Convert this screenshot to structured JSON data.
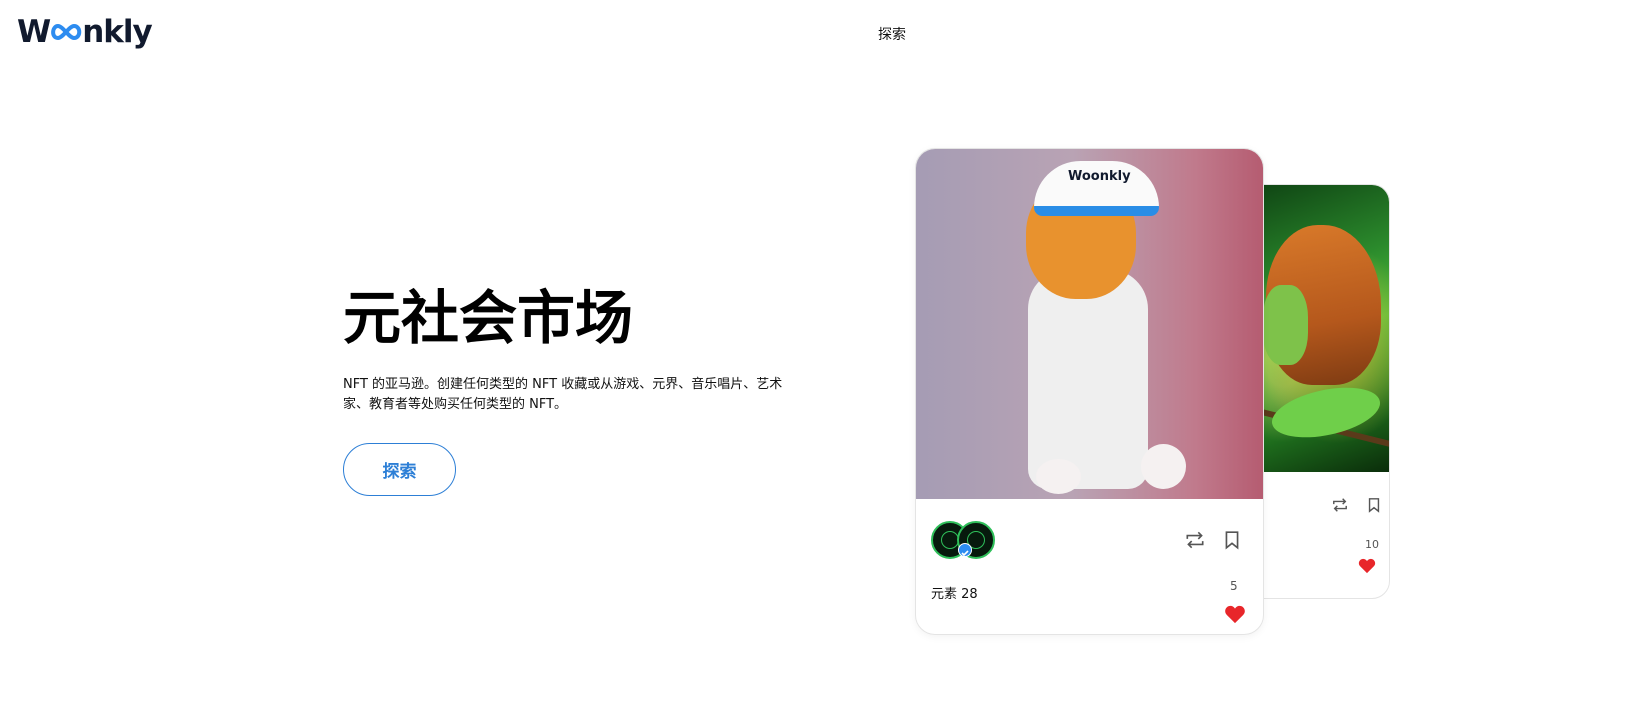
{
  "header": {
    "logo_before": "W",
    "logo_after": "nkly",
    "nav_explore": "探索"
  },
  "hero": {
    "title": "元社会市场",
    "description": "NFT 的亚马逊。创建任何类型的 NFT 收藏或从游戏、元界、音乐唱片、艺术家、教育者等处购买任何类型的 NFT。",
    "button": "探索"
  },
  "cards": [
    {
      "name": "元素 28",
      "likes": "5",
      "image_text": "Woonkly",
      "icons": [
        "repost-icon",
        "bookmark-icon",
        "heart-icon"
      ]
    },
    {
      "likes": "10",
      "icons": [
        "repost-icon",
        "bookmark-icon",
        "heart-icon"
      ]
    }
  ],
  "colors": {
    "accent": "#2d8cf0",
    "button_border": "#2d7fd6",
    "heart": "#e8262a"
  }
}
